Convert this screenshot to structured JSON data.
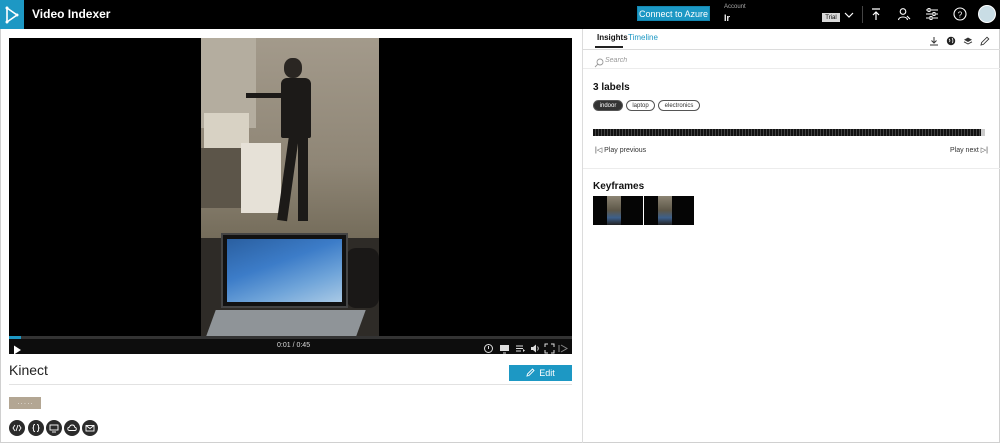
{
  "app": {
    "title": "Video Indexer",
    "connect_label": "Connect to Azure",
    "account_label": "Account",
    "account_value": "lr",
    "trial_badge": "Trial",
    "accent": "#1d98c4",
    "toolbar_icons": [
      "upload-icon",
      "person-icon",
      "settings-icon",
      "help-icon"
    ]
  },
  "player": {
    "time": "0:01 / 0:45",
    "progress": 0.022,
    "controls": [
      "play-icon",
      "subtitles-icon",
      "screen-icon",
      "playlist-icon",
      "volume-icon",
      "fullscreen-icon",
      "cast-icon"
    ]
  },
  "video": {
    "title": "Kinect",
    "edit_label": "Edit",
    "tag_label": ". . . . ."
  },
  "share": {
    "icons": [
      "embed-icon",
      "code-icon",
      "captions-icon",
      "cloud-icon",
      "mail-icon"
    ]
  },
  "insights": {
    "tabs": [
      {
        "label": "Insights",
        "active": true
      },
      {
        "label": "Timeline",
        "active": false
      }
    ],
    "panel_icons": [
      "download-icon",
      "globe-icon",
      "layers-icon",
      "pencil-icon"
    ],
    "search_placeholder": "Search",
    "labels_title": "3 labels",
    "labels": [
      {
        "name": "indoor",
        "selected": true
      },
      {
        "name": "laptop",
        "selected": false
      },
      {
        "name": "electronics",
        "selected": false
      }
    ],
    "play_previous": "Play previous",
    "play_next": "Play next",
    "keyframes_title": "Keyframes",
    "keyframe_count": 2
  }
}
